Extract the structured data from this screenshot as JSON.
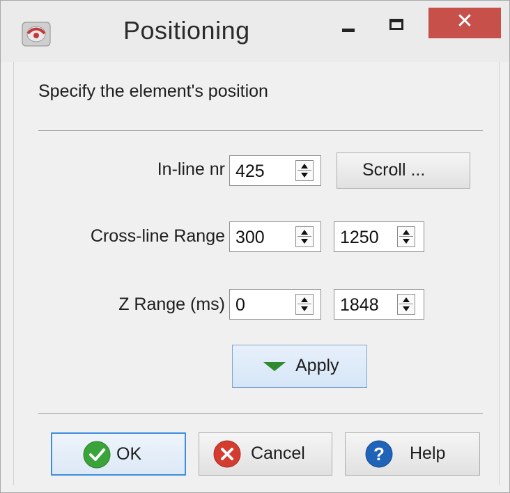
{
  "window": {
    "title": "Positioning",
    "close_glyph": "✕",
    "icons": {
      "app": "app-logo-icon",
      "minimize": "minimize-icon",
      "maximize": "maximize-icon",
      "close": "close-icon"
    }
  },
  "dialog": {
    "subtitle": "Specify the element's position",
    "inline": {
      "label": "In-line nr",
      "value": "425",
      "scroll_label": "Scroll ..."
    },
    "crossline": {
      "label": "Cross-line Range",
      "start": "300",
      "stop": "1250"
    },
    "zrange": {
      "label": "Z Range (ms)",
      "start": "0",
      "stop": "1848"
    },
    "apply_label": "Apply",
    "apply_icon": "arrow-down-icon"
  },
  "footer": {
    "ok_label": "OK",
    "cancel_label": "Cancel",
    "help_label": "Help",
    "ok_icon": "checkmark-icon",
    "cancel_icon": "cancel-icon",
    "help_icon": "help-icon",
    "help_glyph": "?",
    "colors": {
      "ok": "#3aa33a",
      "cancel": "#d43c2f",
      "help": "#1f64b8"
    }
  }
}
